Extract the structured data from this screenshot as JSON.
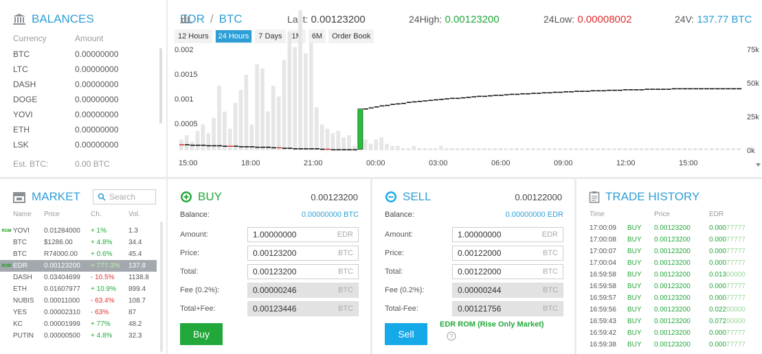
{
  "balances": {
    "title": "BALANCES",
    "col_currency": "Currency",
    "col_amount": "Amount",
    "rows": [
      {
        "currency": "BTC",
        "amount": "0.00000000"
      },
      {
        "currency": "LTC",
        "amount": "0.00000000"
      },
      {
        "currency": "DASH",
        "amount": "0.00000000"
      },
      {
        "currency": "DOGE",
        "amount": "0.00000000"
      },
      {
        "currency": "YOVI",
        "amount": "0.00000000"
      },
      {
        "currency": "ETH",
        "amount": "0.00000000"
      },
      {
        "currency": "LSK",
        "amount": "0.00000000"
      }
    ],
    "est_label": "Est. BTC:",
    "est_value": "0.00 BTC"
  },
  "market": {
    "title": "MARKET",
    "search_placeholder": "Search",
    "cols": {
      "name": "Name",
      "price": "Price",
      "change": "Ch.",
      "vol": "Vol."
    },
    "rows": [
      {
        "tag": "ROM",
        "name": "YOVI",
        "price": "0.01284000",
        "change": "+ 1%",
        "dir": "up",
        "vol": "1.3"
      },
      {
        "tag": "",
        "name": "BTC",
        "price": "$1286.00",
        "change": "+ 4.8%",
        "dir": "up",
        "vol": "34.4"
      },
      {
        "tag": "",
        "name": "BTC",
        "price": "R74000.00",
        "change": "+ 0.6%",
        "dir": "up",
        "vol": "45.4"
      },
      {
        "tag": "ROM",
        "name": "EDR",
        "price": "0.00123200",
        "change": "+ 777.3%",
        "dir": "up",
        "vol": "137.8"
      },
      {
        "tag": "",
        "name": "DASH",
        "price": "0.03404699",
        "change": "- 10.5%",
        "dir": "down",
        "vol": "1138.8"
      },
      {
        "tag": "",
        "name": "ETH",
        "price": "0.01607977",
        "change": "+ 10.9%",
        "dir": "up",
        "vol": "899.4"
      },
      {
        "tag": "",
        "name": "NUBIS",
        "price": "0.00011000",
        "change": "- 63.4%",
        "dir": "down",
        "vol": "108.7"
      },
      {
        "tag": "",
        "name": "YES",
        "price": "0.00002310",
        "change": "- 63%",
        "dir": "down",
        "vol": "87"
      },
      {
        "tag": "",
        "name": "KC",
        "price": "0.00001999",
        "change": "+ 77%",
        "dir": "up",
        "vol": "48.2"
      },
      {
        "tag": "",
        "name": "PUTIN",
        "price": "0.00000500",
        "change": "+ 4.8%",
        "dir": "up",
        "vol": "32.3"
      }
    ]
  },
  "header": {
    "base": "EDR",
    "sep": "/",
    "quote": "BTC",
    "last_label": "Last:",
    "last_value": "0.00123200",
    "high_label": "24High:",
    "high_value": "0.00123200",
    "low_label": "24Low:",
    "low_value": "0.00008002",
    "vol_label": "24V:",
    "vol_value": "137.77 BTC"
  },
  "tabs": [
    {
      "label": "12 Hours",
      "active": false
    },
    {
      "label": "24 Hours",
      "active": true
    },
    {
      "label": "7 Days",
      "active": false
    },
    {
      "label": "1M",
      "active": false
    },
    {
      "label": "6M",
      "active": false
    },
    {
      "label": "Order Book",
      "active": false
    }
  ],
  "chart_data": {
    "type": "bar",
    "y_ticks": [
      "0.002",
      "0.0015",
      "0.001",
      "0.0005"
    ],
    "y2_ticks": [
      "75k",
      "50k",
      "25k",
      "0k"
    ],
    "x_ticks": [
      "15:00",
      "18:00",
      "21:00",
      "00:00",
      "03:00",
      "06:00",
      "09:00",
      "12:00",
      "15:00"
    ],
    "price_ylim": [
      0,
      0.002
    ],
    "volume_ylim": [
      0,
      75000
    ],
    "volume": [
      5,
      7,
      4,
      9,
      12,
      8,
      15,
      30,
      18,
      10,
      22,
      28,
      35,
      12,
      40,
      38,
      18,
      30,
      25,
      42,
      55,
      48,
      65,
      45,
      50,
      20,
      12,
      10,
      8,
      9,
      6,
      7,
      2,
      2,
      5,
      3,
      5,
      6,
      3,
      2,
      2,
      1,
      1,
      2,
      1,
      1,
      1,
      1,
      2,
      1,
      1,
      1,
      1,
      1,
      1,
      1,
      1,
      1,
      1,
      1,
      1,
      1,
      1,
      1,
      1,
      1,
      1,
      1,
      1,
      1,
      1,
      1,
      1,
      1,
      1,
      1,
      1,
      1,
      1,
      1,
      1,
      1,
      1,
      1,
      1,
      1,
      1,
      1,
      1,
      1,
      1,
      1,
      1,
      1,
      1,
      1,
      1,
      1,
      1,
      1,
      1,
      1,
      1,
      1
    ],
    "price": [
      0.00012,
      0.00011,
      0.00011,
      0.00011,
      0.0001,
      0.0001,
      0.0001,
      9e-05,
      9e-05,
      9e-05,
      8e-05,
      8e-05,
      8e-05,
      7e-05,
      7e-05,
      7e-05,
      6e-05,
      6e-05,
      5e-05,
      5e-05,
      4e-05,
      4e-05,
      4e-05,
      4e-05,
      4e-05,
      3e-05,
      3e-05,
      2e-05,
      2e-05,
      2e-05,
      2e-05,
      2e-05,
      2e-05,
      0.00082,
      0.00083,
      0.00085,
      0.00087,
      0.00089,
      0.0009,
      0.00092,
      0.00093,
      0.00094,
      0.00096,
      0.00097,
      0.00098,
      0.00099,
      0.001,
      0.00101,
      0.00102,
      0.00103,
      0.00104,
      0.00104,
      0.00105,
      0.00106,
      0.00107,
      0.00108,
      0.00108,
      0.00109,
      0.0011,
      0.0011,
      0.00111,
      0.00112,
      0.00112,
      0.00113,
      0.00113,
      0.00114,
      0.00114,
      0.00115,
      0.00115,
      0.00116,
      0.00116,
      0.00117,
      0.00117,
      0.00118,
      0.00118,
      0.00118,
      0.00119,
      0.00119,
      0.00119,
      0.0012,
      0.0012,
      0.0012,
      0.00121,
      0.00121,
      0.00121,
      0.00121,
      0.00122,
      0.00122,
      0.00122,
      0.00122,
      0.00122,
      0.00123,
      0.00123,
      0.00123,
      0.00123,
      0.00123,
      0.00123,
      0.00123,
      0.00123,
      0.00123,
      0.00123,
      0.00123,
      0.00123,
      0.00123
    ]
  },
  "buy": {
    "title": "BUY",
    "top_price": "0.00123200",
    "balance_label": "Balance:",
    "balance_value": "0.00000000 BTC",
    "fields": [
      {
        "label": "Amount:",
        "value": "1.00000000",
        "unit": "EDR",
        "ro": false
      },
      {
        "label": "Price:",
        "value": "0.00123200",
        "unit": "BTC",
        "ro": false
      },
      {
        "label": "Total:",
        "value": "0.00123200",
        "unit": "BTC",
        "ro": false
      },
      {
        "label": "Fee (0.2%):",
        "value": "0.00000246",
        "unit": "BTC",
        "ro": true
      },
      {
        "label": "Total+Fee:",
        "value": "0.00123446",
        "unit": "BTC",
        "ro": true
      }
    ],
    "button": "Buy",
    "button_color": "#22a83a"
  },
  "sell": {
    "title": "SELL",
    "top_price": "0.00122000",
    "balance_label": "Balance:",
    "balance_value": "0.00000000 EDR",
    "fields": [
      {
        "label": "Amount:",
        "value": "1.00000000",
        "unit": "EDR",
        "ro": false
      },
      {
        "label": "Price:",
        "value": "0.00122000",
        "unit": "BTC",
        "ro": false
      },
      {
        "label": "Total:",
        "value": "0.00122000",
        "unit": "BTC",
        "ro": false
      },
      {
        "label": "Fee (0.2%):",
        "value": "0.00000244",
        "unit": "BTC",
        "ro": true
      },
      {
        "label": "Total-Fee:",
        "value": "0.00121756",
        "unit": "BTC",
        "ro": true
      }
    ],
    "button": "Sell",
    "button_color": "#16a9e8",
    "note": "EDR ROM (Rise Only Market)"
  },
  "history": {
    "title": "TRADE HISTORY",
    "cols": {
      "time": "Time",
      "price": "Price",
      "amount": "EDR"
    },
    "rows": [
      {
        "time": "17:00:09",
        "side": "BUY",
        "price": "0.00123200",
        "amount_main": "0.000",
        "amount_tail": "77777"
      },
      {
        "time": "17:00:08",
        "side": "BUY",
        "price": "0.00123200",
        "amount_main": "0.000",
        "amount_tail": "77777"
      },
      {
        "time": "17:00:07",
        "side": "BUY",
        "price": "0.00123200",
        "amount_main": "0.000",
        "amount_tail": "77777"
      },
      {
        "time": "17:00:04",
        "side": "BUY",
        "price": "0.00123200",
        "amount_main": "0.000",
        "amount_tail": "77777"
      },
      {
        "time": "16:59:58",
        "side": "BUY",
        "price": "0.00123200",
        "amount_main": "0.013",
        "amount_tail": "00000"
      },
      {
        "time": "16:59:58",
        "side": "BUY",
        "price": "0.00123200",
        "amount_main": "0.000",
        "amount_tail": "77777"
      },
      {
        "time": "16:59:57",
        "side": "BUY",
        "price": "0.00123200",
        "amount_main": "0.000",
        "amount_tail": "77777"
      },
      {
        "time": "16:59:56",
        "side": "BUY",
        "price": "0.00123200",
        "amount_main": "0.022",
        "amount_tail": "00000"
      },
      {
        "time": "16:59:43",
        "side": "BUY",
        "price": "0.00123200",
        "amount_main": "0.072",
        "amount_tail": "00000"
      },
      {
        "time": "16:59:42",
        "side": "BUY",
        "price": "0.00123200",
        "amount_main": "0.000",
        "amount_tail": "77777"
      },
      {
        "time": "16:59:38",
        "side": "BUY",
        "price": "0.00123200",
        "amount_main": "0.000",
        "amount_tail": "77777"
      }
    ]
  }
}
